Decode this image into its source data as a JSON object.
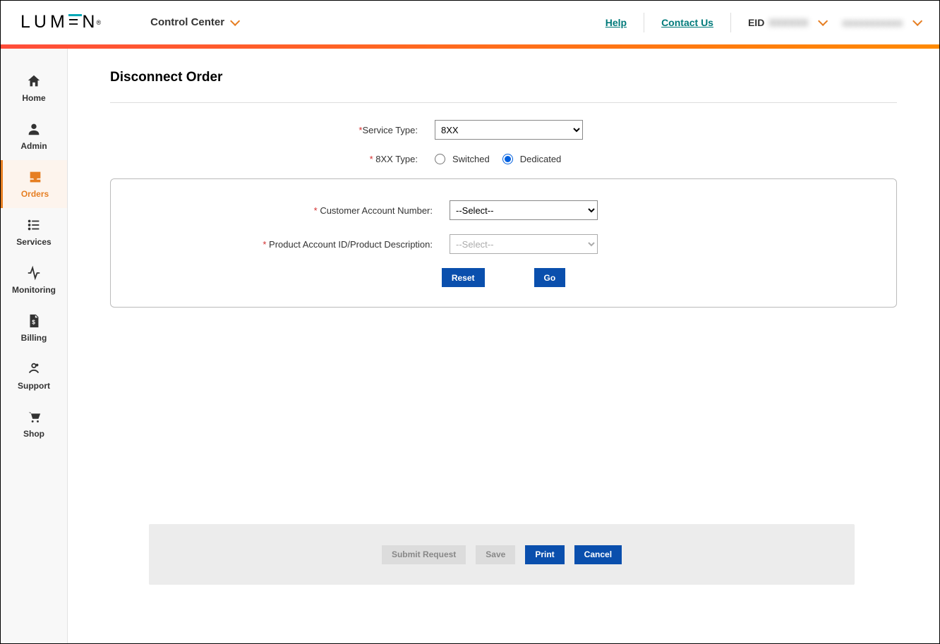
{
  "header": {
    "logo_text": "LUM=N",
    "app_name": "Control Center",
    "help": "Help",
    "contact": "Contact Us",
    "eid_label": "EID",
    "eid_value": "XXXXXX",
    "user_value": "xxxxxxxxxxx"
  },
  "sidebar": {
    "items": [
      {
        "id": "home",
        "label": "Home"
      },
      {
        "id": "admin",
        "label": "Admin"
      },
      {
        "id": "orders",
        "label": "Orders"
      },
      {
        "id": "services",
        "label": "Services"
      },
      {
        "id": "monitoring",
        "label": "Monitoring"
      },
      {
        "id": "billing",
        "label": "Billing"
      },
      {
        "id": "support",
        "label": "Support"
      },
      {
        "id": "shop",
        "label": "Shop"
      }
    ]
  },
  "page": {
    "title": "Disconnect Order",
    "service_type_label": "Service Type:",
    "service_type_value": "8XX",
    "eightxx_type_label": "8XX Type:",
    "switched": "Switched",
    "dedicated": "Dedicated",
    "eightxx_selected": "dedicated",
    "customer_acct_label": "Customer Account Number:",
    "customer_acct_placeholder": "--Select--",
    "product_acct_label": "Product Account ID/Product Description:",
    "product_acct_placeholder": "--Select--",
    "reset_btn": "Reset",
    "go_btn": "Go"
  },
  "footer": {
    "submit": "Submit Request",
    "save": "Save",
    "print": "Print",
    "cancel": "Cancel"
  },
  "colors": {
    "accent_orange": "#e67e22",
    "accent_teal": "#007a7a",
    "btn_blue": "#0a4fad"
  }
}
